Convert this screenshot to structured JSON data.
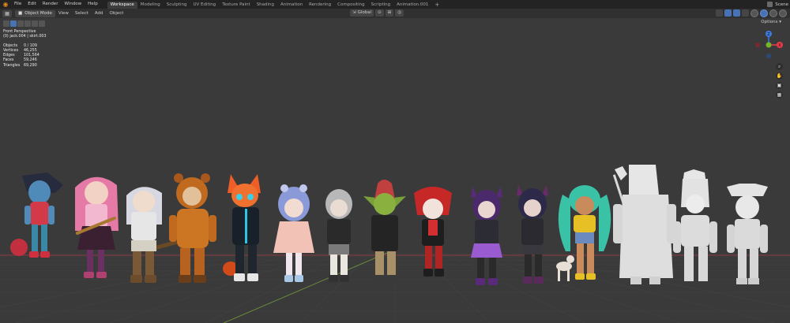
{
  "menubar": {
    "items": [
      "File",
      "Edit",
      "Render",
      "Window",
      "Help"
    ],
    "tabs": [
      "Workspace",
      "Modeling",
      "Sculpting",
      "UV Editing",
      "Texture Paint",
      "Shading",
      "Animation",
      "Rendering",
      "Compositing",
      "Scripting",
      "Animation.001"
    ],
    "active_tab": "Workspace",
    "add_tab": "+",
    "scene_label": "Scene"
  },
  "viewport_header": {
    "mode": "Object Mode",
    "menus": [
      "View",
      "Select",
      "Add",
      "Object"
    ],
    "orientation": "Global"
  },
  "options_label": "Options",
  "overlay": {
    "view_name": "Front Perspective",
    "collection_line": "(0) jack.004 | skirt.003",
    "stats": [
      {
        "key": "Objects",
        "value": "0 / 109"
      },
      {
        "key": "Vertices",
        "value": "46,255"
      },
      {
        "key": "Edges",
        "value": "101,564"
      },
      {
        "key": "Faces",
        "value": "59,246"
      },
      {
        "key": "Triangles",
        "value": "69,290"
      }
    ]
  },
  "gizmo": {
    "x_label": "X",
    "y_label": "Y",
    "z_label": "Z"
  },
  "colors": {
    "accent_blue": "#4772b3",
    "axis_x": "#e83a4a",
    "axis_y": "#76b42b",
    "axis_z": "#3c7be0",
    "blender_orange": "#e0871f"
  }
}
